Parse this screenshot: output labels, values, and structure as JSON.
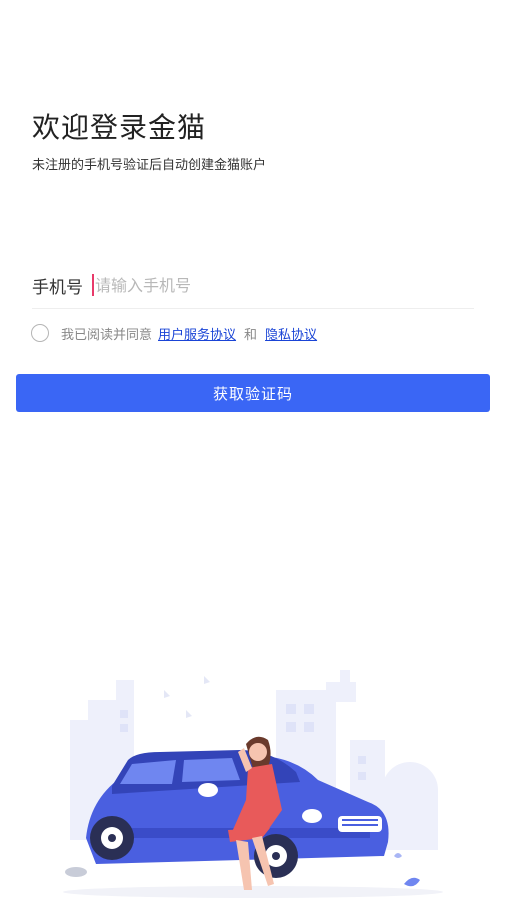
{
  "header": {
    "title": "欢迎登录金猫",
    "subtitle": "未注册的手机号验证后自动创建金猫账户"
  },
  "form": {
    "phone_label": "手机号",
    "phone_placeholder": "请输入手机号",
    "phone_value": ""
  },
  "agreement": {
    "prefix": "我已阅读并同意",
    "terms_link": "用户服务协议",
    "and_text": "和",
    "privacy_link": "隐私协议",
    "checked": false
  },
  "submit": {
    "label": "获取验证码"
  },
  "colors": {
    "primary": "#3a66f5",
    "link": "#1a44d6",
    "caret": "#e83a6a",
    "car": "#4a5fe0"
  },
  "illustration": {
    "icon": "woman-leaning-on-car-illustration"
  }
}
